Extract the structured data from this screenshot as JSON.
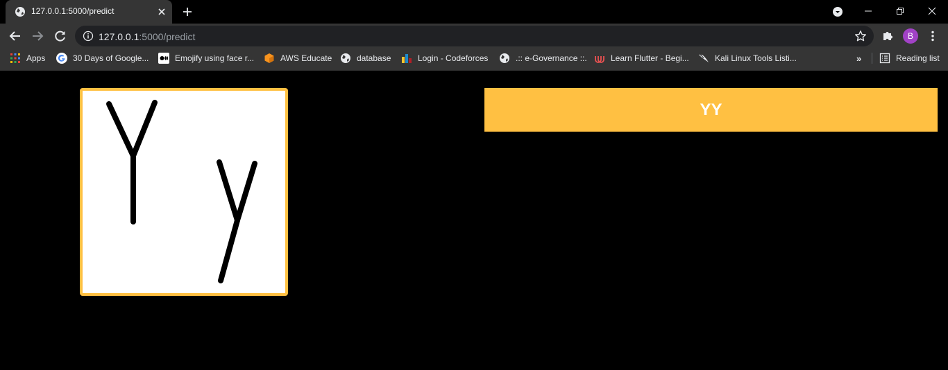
{
  "browser": {
    "tab": {
      "title": "127.0.0.1:5000/predict"
    },
    "url": {
      "host": "127.0.0.1",
      "path": ":5000/predict"
    },
    "profile_initial": "B",
    "colors": {
      "frame": "#000000",
      "toolbar": "#353535",
      "omnibox": "#202124",
      "avatar": "#a142c6"
    }
  },
  "bookmarks": [
    {
      "label": "Apps",
      "icon": "apps-grid-icon"
    },
    {
      "label": "30 Days of Google...",
      "icon": "google-icon"
    },
    {
      "label": "Emojify using face r...",
      "icon": "medium-icon"
    },
    {
      "label": "AWS Educate",
      "icon": "aws-cube-icon"
    },
    {
      "label": "database",
      "icon": "globe-icon"
    },
    {
      "label": "Login - Codeforces",
      "icon": "codeforces-icon"
    },
    {
      "label": ".:: e-Governance ::.",
      "icon": "globe-icon"
    },
    {
      "label": "Learn Flutter - Begi...",
      "icon": "udemy-icon"
    },
    {
      "label": "Kali Linux Tools Listi...",
      "icon": "kali-dragon-icon"
    }
  ],
  "reading_list": {
    "label": "Reading list",
    "icon": "reading-list-icon"
  },
  "page": {
    "prediction": "YY",
    "accent_color": "#ffc042",
    "background": "#000000"
  }
}
